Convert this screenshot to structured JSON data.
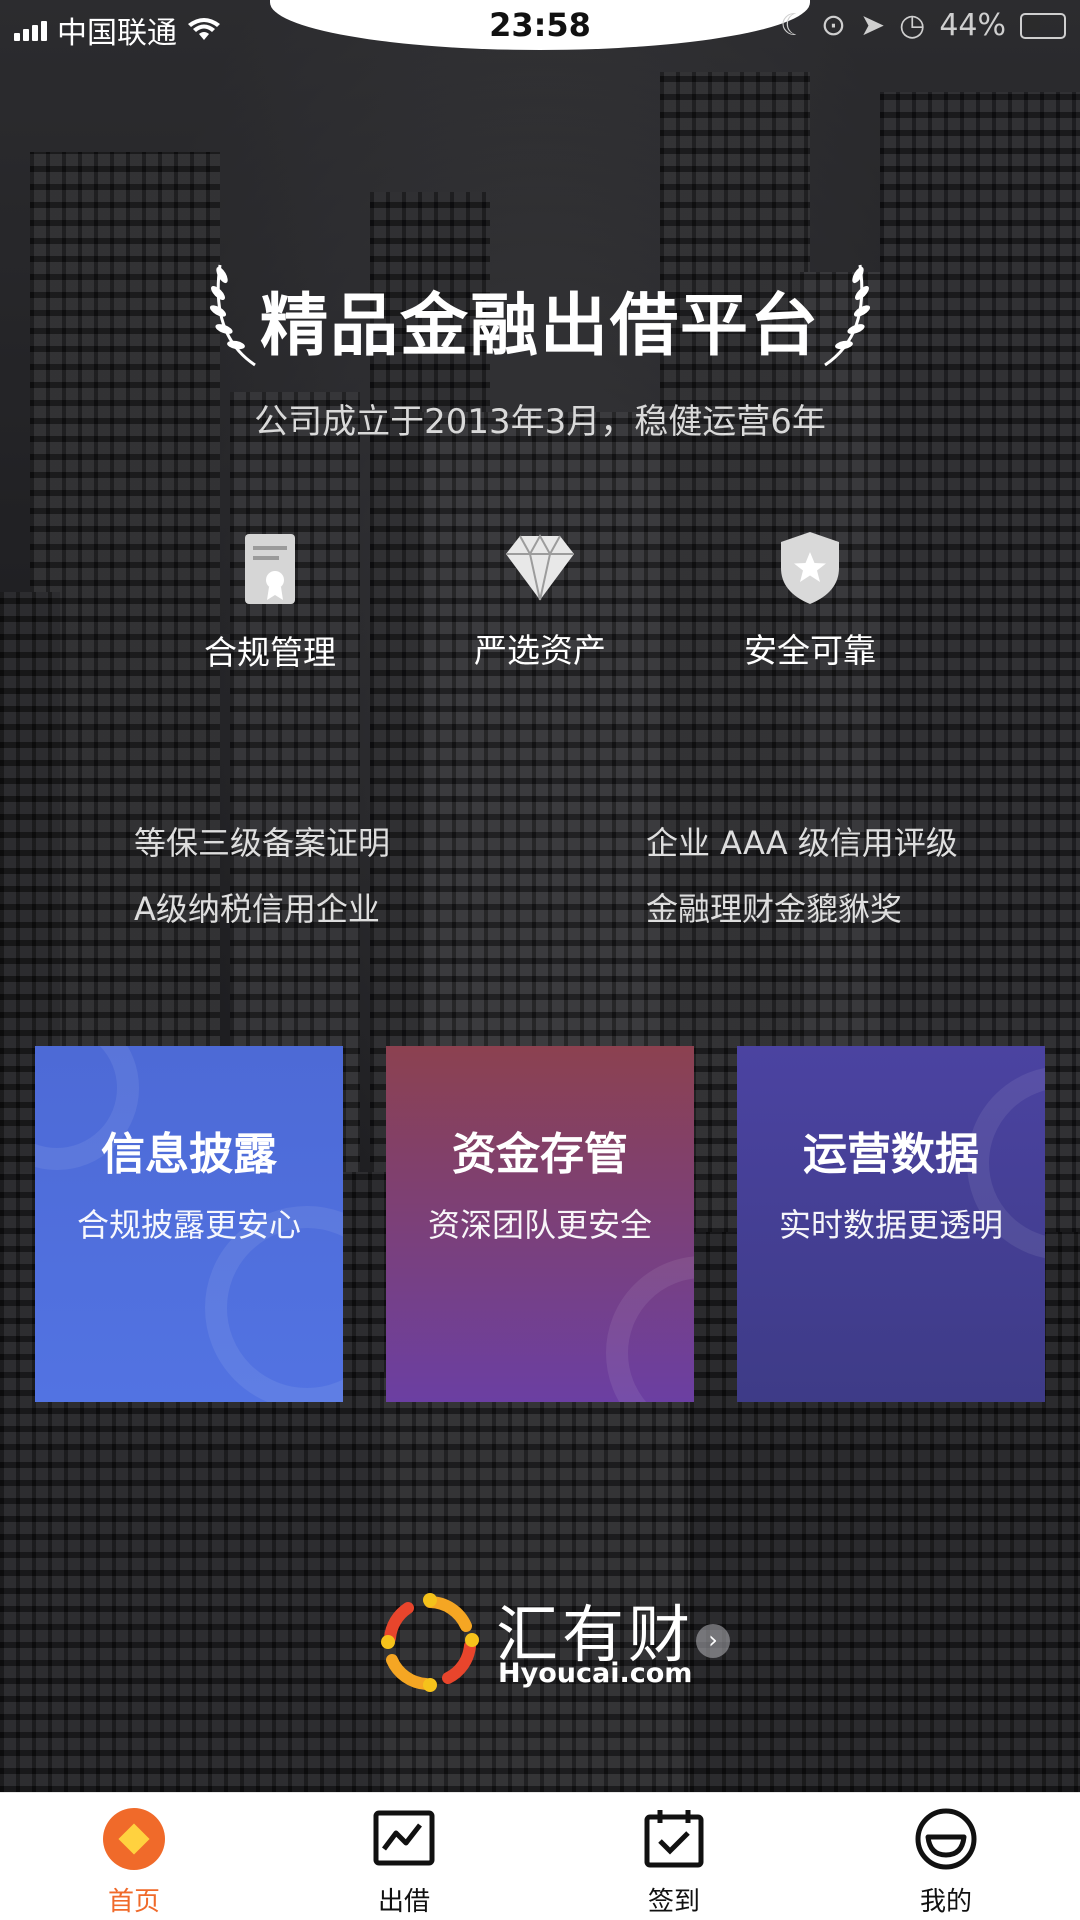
{
  "status_bar": {
    "carrier": "中国联通",
    "time": "23:58",
    "battery": "44%"
  },
  "hero": {
    "title": "精品金融出借平台",
    "subtitle": "公司成立于2013年3月，稳健运营6年"
  },
  "features": [
    {
      "label": "合规管理",
      "icon": "certificate-icon"
    },
    {
      "label": "严选资产",
      "icon": "diamond-icon"
    },
    {
      "label": "安全可靠",
      "icon": "shield-star-icon"
    }
  ],
  "certifications": [
    "等保三级备案证明",
    "企业 AAA 级信用评级",
    "A级纳税信用企业",
    "金融理财金貔貅奖"
  ],
  "cards": [
    {
      "title": "信息披露",
      "subtitle": "合规披露更安心",
      "color": "#5070dc"
    },
    {
      "title": "资金存管",
      "subtitle": "资深团队更安全",
      "color": "#7a4080"
    },
    {
      "title": "运营数据",
      "subtitle": "实时数据更透明",
      "color": "#463f94"
    }
  ],
  "brand": {
    "name_cn": "汇有财",
    "name_en": "Hyoucai.com"
  },
  "tabbar": {
    "active_color": "#f06a2a",
    "items": [
      {
        "label": "首页",
        "icon": "home-diamond-icon",
        "active": true
      },
      {
        "label": "出借",
        "icon": "chart-icon",
        "active": false
      },
      {
        "label": "签到",
        "icon": "calendar-check-icon",
        "active": false
      },
      {
        "label": "我的",
        "icon": "smile-icon",
        "active": false
      }
    ]
  }
}
